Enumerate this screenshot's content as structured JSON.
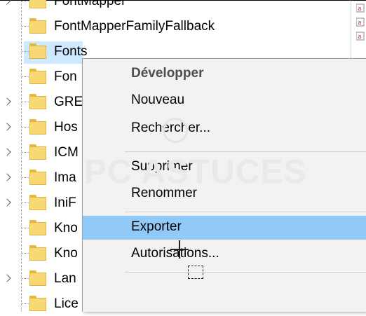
{
  "tree": {
    "items": [
      {
        "label": "FontMapper",
        "expandable": true,
        "selected": false
      },
      {
        "label": "FontMapperFamilyFallback",
        "expandable": false,
        "selected": false
      },
      {
        "label": "Fonts",
        "expandable": false,
        "selected": true
      },
      {
        "label": "Fon",
        "expandable": false,
        "selected": false
      },
      {
        "label": "GRE",
        "expandable": true,
        "selected": false
      },
      {
        "label": "Hos",
        "expandable": true,
        "selected": false
      },
      {
        "label": "ICM",
        "expandable": true,
        "selected": false
      },
      {
        "label": "Ima",
        "expandable": true,
        "selected": false
      },
      {
        "label": "IniF",
        "expandable": true,
        "selected": false
      },
      {
        "label": "Kno",
        "expandable": false,
        "selected": false
      },
      {
        "label": "Kno",
        "expandable": false,
        "selected": false
      },
      {
        "label": "Lan",
        "expandable": true,
        "selected": false
      },
      {
        "label": "Lice",
        "expandable": false,
        "selected": false
      }
    ]
  },
  "context_menu": {
    "items": [
      {
        "label": "Développer",
        "default": true
      },
      {
        "label": "Nouveau"
      },
      {
        "label": "Rechercher..."
      },
      {
        "separator": true
      },
      {
        "label": "Supprimer"
      },
      {
        "label": "Renommer"
      },
      {
        "separator": true
      },
      {
        "label": "Exporter",
        "hover": true
      },
      {
        "label": "Autorisations..."
      },
      {
        "separator": true
      }
    ]
  },
  "watermark": {
    "text": "PC ASTUCES"
  },
  "colors": {
    "selection": "#cde8ff",
    "menu_hover": "#91c9f7",
    "menu_bg": "#f2f2f2",
    "folder": "#f8d775"
  },
  "icons": {
    "tree_folder": "folder-icon",
    "tree_expander": "chevron-right-icon",
    "cursor": "move-cursor-icon",
    "right_pane": "registry-value-icon"
  }
}
